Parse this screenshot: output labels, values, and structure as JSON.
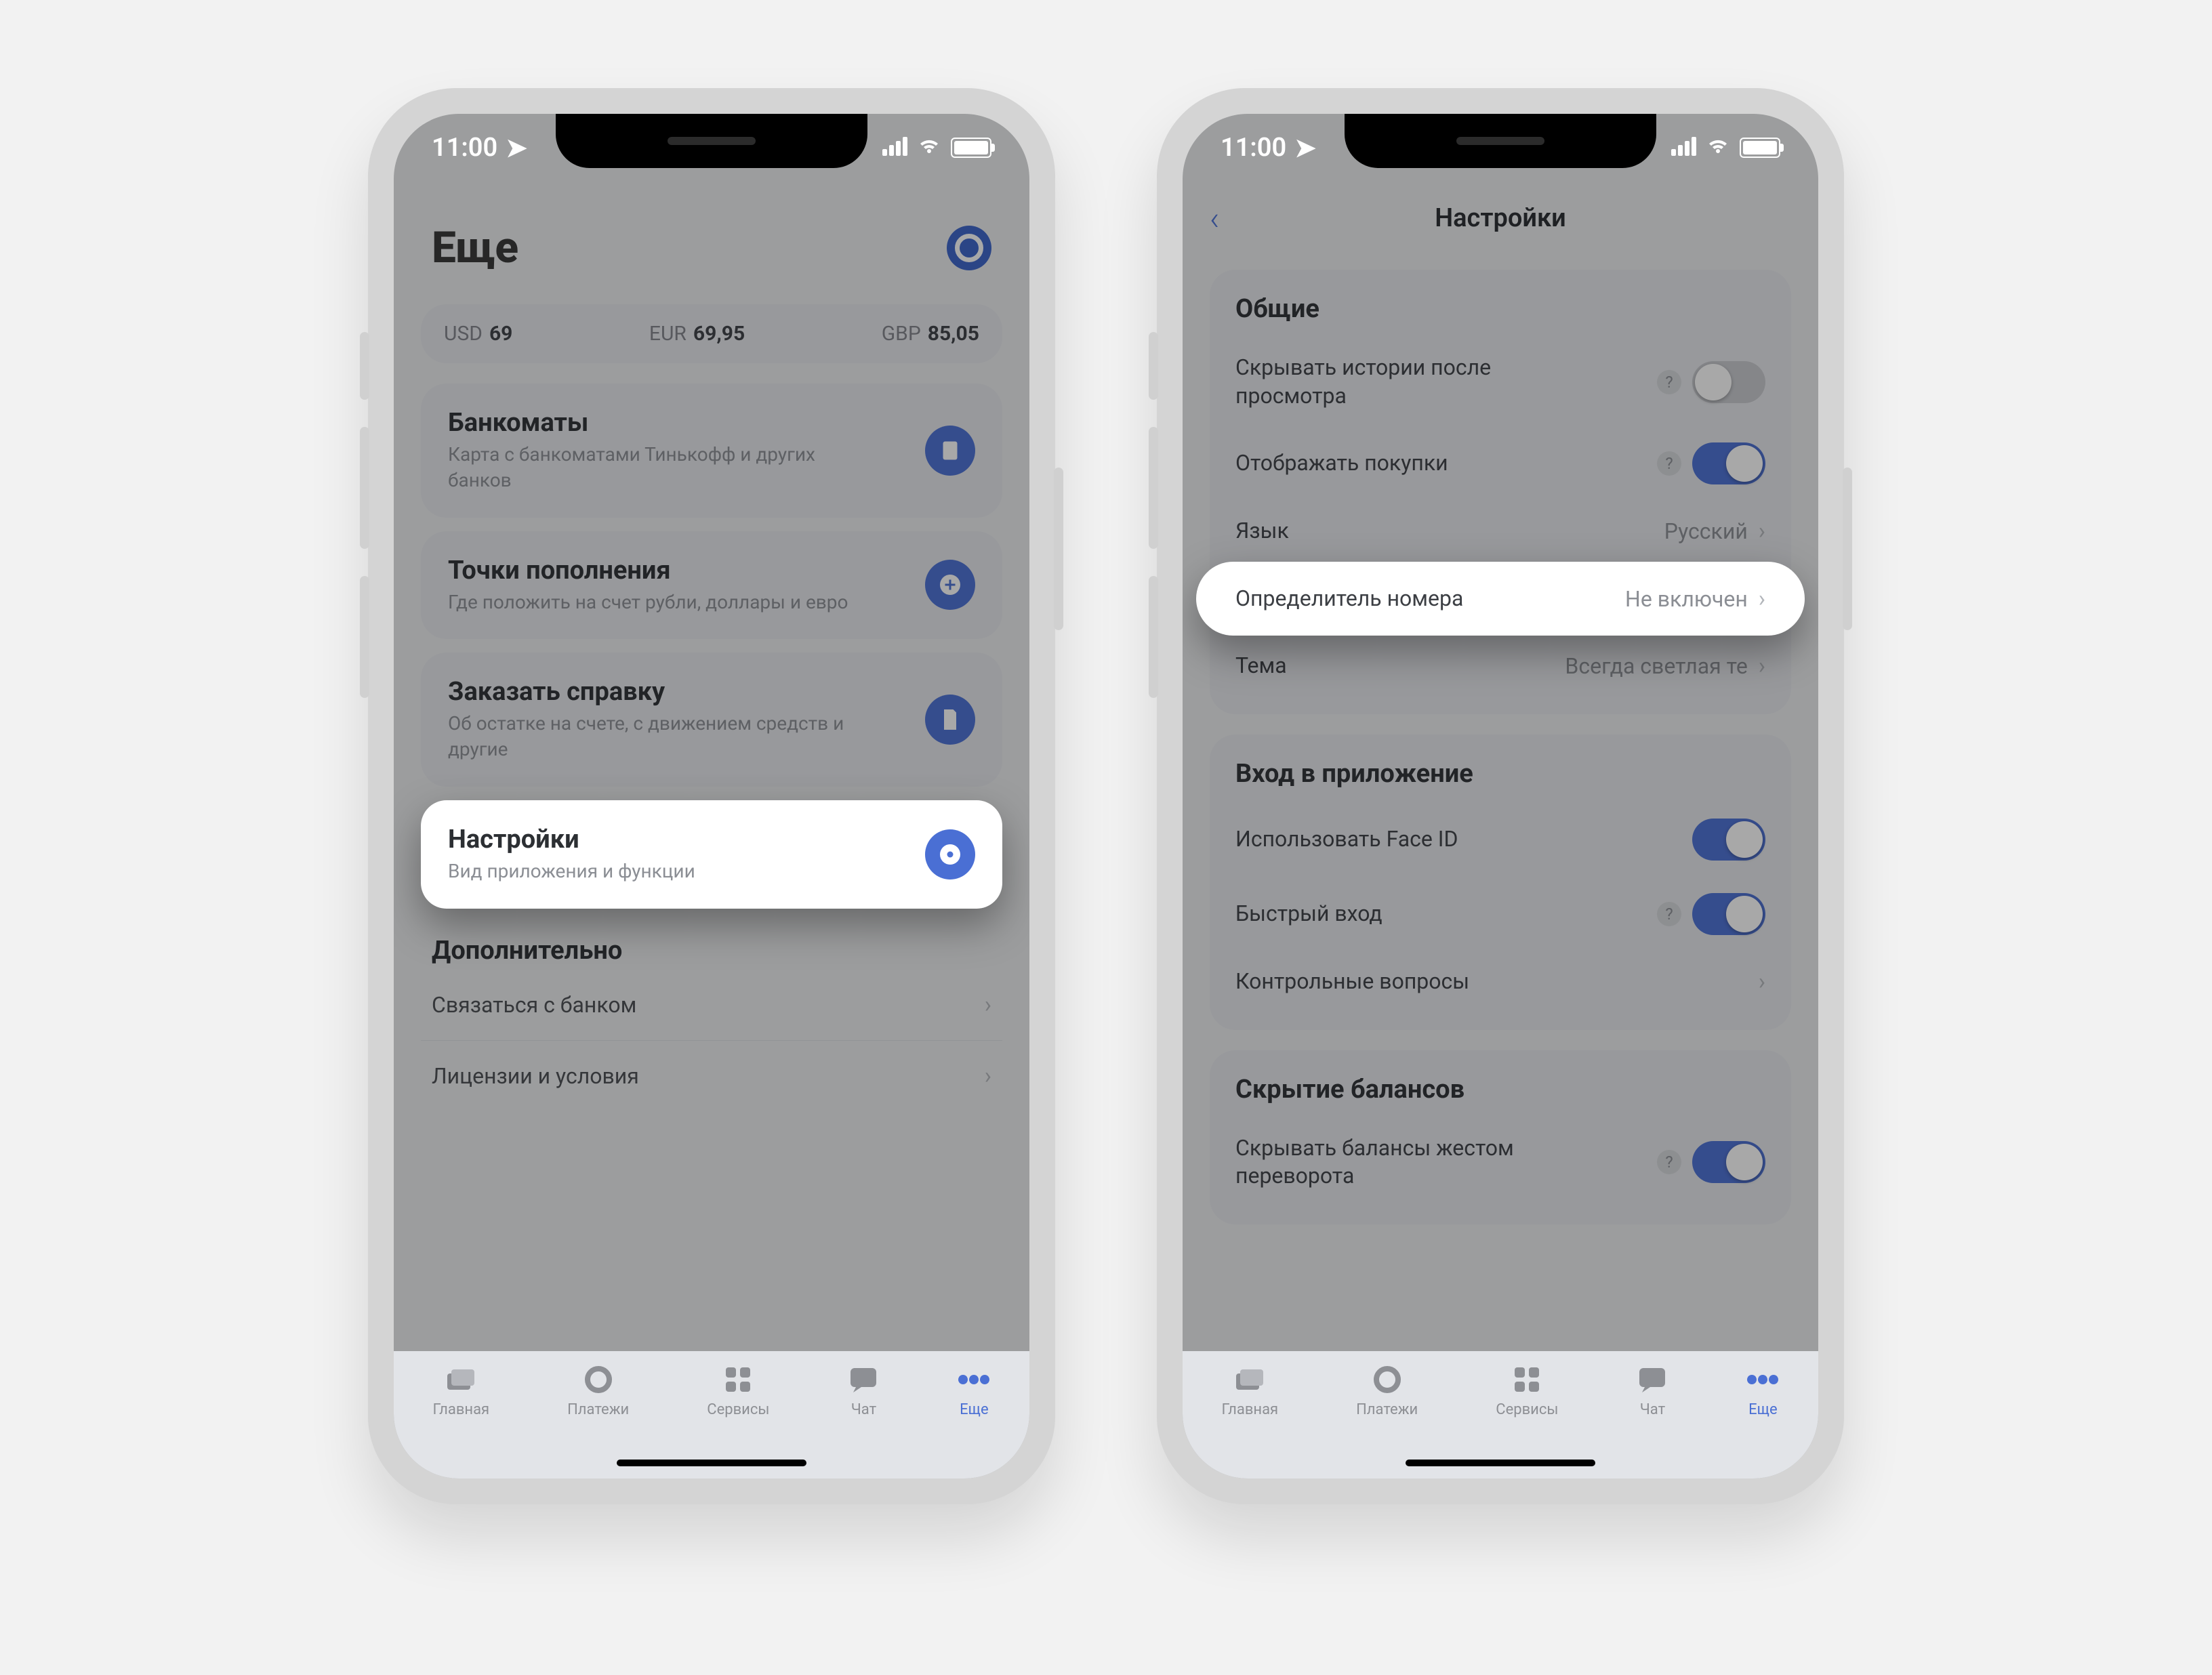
{
  "status": {
    "time": "11:00"
  },
  "phone1": {
    "header_title": "Еще",
    "rates": [
      {
        "code": "USD",
        "value": "69"
      },
      {
        "code": "EUR",
        "value": "69,95"
      },
      {
        "code": "GBP",
        "value": "85,05"
      }
    ],
    "cards": {
      "atm": {
        "title": "Банкоматы",
        "subtitle": "Карта с банкоматами Тинькофф и других банков"
      },
      "topup": {
        "title": "Точки пополнения",
        "subtitle": "Где положить на счет рубли, доллары и евро"
      },
      "cert": {
        "title": "Заказать справку",
        "subtitle": "Об остатке на счете, с движением средств и другие"
      },
      "settings": {
        "title": "Настройки",
        "subtitle": "Вид приложения и функции"
      }
    },
    "extra_section": "Дополнительно",
    "extra_rows": {
      "contact": "Связаться с банком",
      "license": "Лицензии и условия"
    }
  },
  "phone2": {
    "nav_title": "Настройки",
    "group_general": {
      "title": "Общие",
      "hide_stories": "Скрывать истории после просмотра",
      "show_purchases": "Отображать покупки",
      "language_label": "Язык",
      "language_value": "Русский",
      "callerid_label": "Определитель номера",
      "callerid_value": "Не включен",
      "theme_label": "Тема",
      "theme_value": "Всегда светлая те"
    },
    "group_login": {
      "title": "Вход в приложение",
      "faceid": "Использовать Face ID",
      "quick": "Быстрый вход",
      "questions": "Контрольные вопросы"
    },
    "group_balance": {
      "title": "Скрытие балансов",
      "hide": "Скрывать балансы жестом переворота"
    }
  },
  "tabs": {
    "home": "Главная",
    "payments": "Платежи",
    "services": "Сервисы",
    "chat": "Чат",
    "more": "Еще"
  }
}
